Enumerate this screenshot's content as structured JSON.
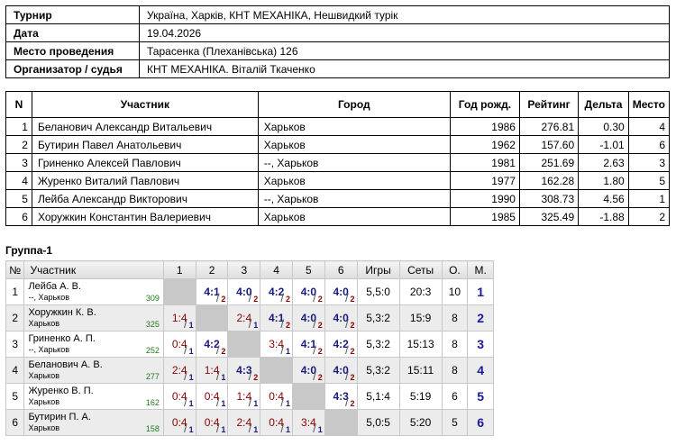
{
  "info": [
    {
      "key": "Турнир",
      "value": "Україна, Харків, КНТ МЕХАНІКА, Нешвидкий турік"
    },
    {
      "key": "Дата",
      "value": "19.04.2026"
    },
    {
      "key": "Место проведения",
      "value": "Тарасенка (Плеханівська) 126"
    },
    {
      "key": "Организатор / судья",
      "value": "КНТ МЕХАНІКА. Віталій Ткаченко"
    }
  ],
  "participants": {
    "headers": [
      "N",
      "Участник",
      "Город",
      "Год рожд.",
      "Рейтинг",
      "Дельта",
      "Место"
    ],
    "rows": [
      [
        "1",
        "Беланович Александр Витальевич",
        "Харьков",
        "1986",
        "276.81",
        "0.30",
        "4"
      ],
      [
        "2",
        "Бутирин Павел Анатольевич",
        "Харьков",
        "1962",
        "157.60",
        "-1.01",
        "6"
      ],
      [
        "3",
        "Гриненко Алексей Павлович",
        "--, Харьков",
        "1981",
        "251.69",
        "2.63",
        "3"
      ],
      [
        "4",
        "Журенко Виталий Павлович",
        "Харьков",
        "1977",
        "162.28",
        "1.80",
        "5"
      ],
      [
        "5",
        "Лейба Александр Викторович",
        "--, Харьков",
        "1990",
        "308.73",
        "4.56",
        "1"
      ],
      [
        "6",
        "Хоружкин Константин Валериевич",
        "Харьков",
        "1985",
        "325.49",
        "-1.88",
        "2"
      ]
    ]
  },
  "group": {
    "title": "Группа-1",
    "headers": [
      "№",
      "Участник",
      "1",
      "2",
      "3",
      "4",
      "5",
      "6",
      "Игры",
      "Сеты",
      "О.",
      "М."
    ],
    "rows": [
      {
        "n": "1",
        "name": "Лейба А. В.",
        "city": "--, Харьков",
        "rating": "309",
        "cells": [
          null,
          [
            "4:1",
            "2",
            "w"
          ],
          [
            "4:0",
            "2",
            "w"
          ],
          [
            "4:2",
            "2",
            "w"
          ],
          [
            "4:0",
            "2",
            "w"
          ],
          [
            "4:0",
            "2",
            "w"
          ]
        ],
        "games": "5,5:0",
        "sets": "20:3",
        "points": "10",
        "place": "1"
      },
      {
        "n": "2",
        "name": "Хоружкин К. В.",
        "city": "Харьков",
        "rating": "325",
        "cells": [
          [
            "1:4",
            "1",
            "l"
          ],
          null,
          [
            "2:4",
            "1",
            "l"
          ],
          [
            "4:1",
            "2",
            "w"
          ],
          [
            "4:0",
            "2",
            "w"
          ],
          [
            "4:0",
            "2",
            "w"
          ]
        ],
        "games": "5,3:2",
        "sets": "15:9",
        "points": "8",
        "place": "2"
      },
      {
        "n": "3",
        "name": "Гриненко А. П.",
        "city": "--, Харьков",
        "rating": "252",
        "cells": [
          [
            "0:4",
            "1",
            "l"
          ],
          [
            "4:2",
            "2",
            "w"
          ],
          null,
          [
            "3:4",
            "1",
            "l"
          ],
          [
            "4:1",
            "2",
            "w"
          ],
          [
            "4:2",
            "2",
            "w"
          ]
        ],
        "games": "5,3:2",
        "sets": "15:13",
        "points": "8",
        "place": "3"
      },
      {
        "n": "4",
        "name": "Беланович А. В.",
        "city": "Харьков",
        "rating": "277",
        "cells": [
          [
            "2:4",
            "1",
            "l"
          ],
          [
            "1:4",
            "1",
            "l"
          ],
          [
            "4:3",
            "2",
            "w"
          ],
          null,
          [
            "4:0",
            "2",
            "w"
          ],
          [
            "4:0",
            "2",
            "w"
          ]
        ],
        "games": "5,3:2",
        "sets": "15:11",
        "points": "8",
        "place": "4"
      },
      {
        "n": "5",
        "name": "Журенко В. П.",
        "city": "Харьков",
        "rating": "162",
        "cells": [
          [
            "0:4",
            "1",
            "l"
          ],
          [
            "0:4",
            "1",
            "l"
          ],
          [
            "1:4",
            "1",
            "l"
          ],
          [
            "0:4",
            "1",
            "l"
          ],
          null,
          [
            "4:3",
            "2",
            "w"
          ]
        ],
        "games": "5,1:4",
        "sets": "5:19",
        "points": "6",
        "place": "5"
      },
      {
        "n": "6",
        "name": "Бутирин П. А.",
        "city": "Харьков",
        "rating": "158",
        "cells": [
          [
            "0:4",
            "1",
            "l"
          ],
          [
            "0:4",
            "1",
            "l"
          ],
          [
            "2:4",
            "1",
            "l"
          ],
          [
            "0:4",
            "1",
            "l"
          ],
          [
            "3:4",
            "1",
            "l"
          ],
          null
        ],
        "games": "5,0:5",
        "sets": "5:20",
        "points": "5",
        "place": "6"
      }
    ]
  }
}
